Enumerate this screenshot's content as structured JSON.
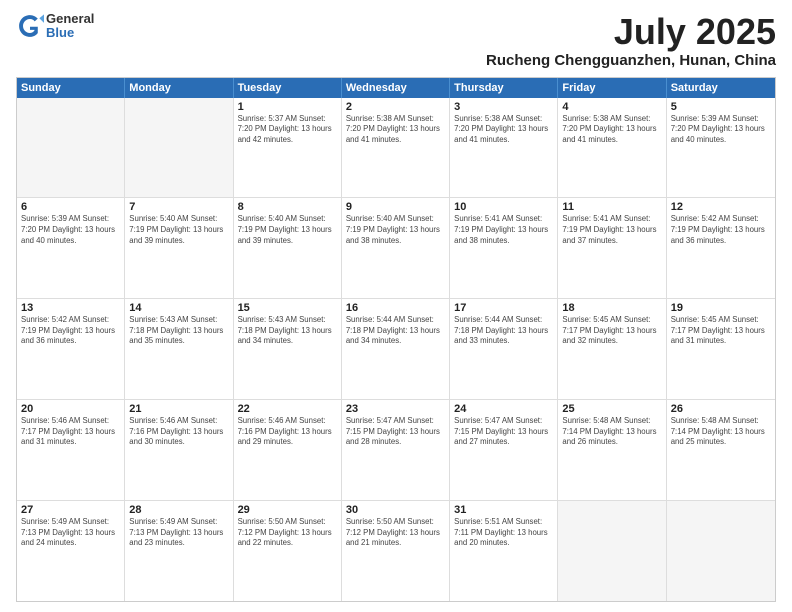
{
  "logo": {
    "general": "General",
    "blue": "Blue"
  },
  "title": "July 2025",
  "subtitle": "Rucheng Chengguanzhen, Hunan, China",
  "days_of_week": [
    "Sunday",
    "Monday",
    "Tuesday",
    "Wednesday",
    "Thursday",
    "Friday",
    "Saturday"
  ],
  "weeks": [
    [
      {
        "day": "",
        "info": "",
        "empty": true
      },
      {
        "day": "",
        "info": "",
        "empty": true
      },
      {
        "day": "1",
        "info": "Sunrise: 5:37 AM\nSunset: 7:20 PM\nDaylight: 13 hours and 42 minutes."
      },
      {
        "day": "2",
        "info": "Sunrise: 5:38 AM\nSunset: 7:20 PM\nDaylight: 13 hours and 41 minutes."
      },
      {
        "day": "3",
        "info": "Sunrise: 5:38 AM\nSunset: 7:20 PM\nDaylight: 13 hours and 41 minutes."
      },
      {
        "day": "4",
        "info": "Sunrise: 5:38 AM\nSunset: 7:20 PM\nDaylight: 13 hours and 41 minutes."
      },
      {
        "day": "5",
        "info": "Sunrise: 5:39 AM\nSunset: 7:20 PM\nDaylight: 13 hours and 40 minutes."
      }
    ],
    [
      {
        "day": "6",
        "info": "Sunrise: 5:39 AM\nSunset: 7:20 PM\nDaylight: 13 hours and 40 minutes."
      },
      {
        "day": "7",
        "info": "Sunrise: 5:40 AM\nSunset: 7:19 PM\nDaylight: 13 hours and 39 minutes."
      },
      {
        "day": "8",
        "info": "Sunrise: 5:40 AM\nSunset: 7:19 PM\nDaylight: 13 hours and 39 minutes."
      },
      {
        "day": "9",
        "info": "Sunrise: 5:40 AM\nSunset: 7:19 PM\nDaylight: 13 hours and 38 minutes."
      },
      {
        "day": "10",
        "info": "Sunrise: 5:41 AM\nSunset: 7:19 PM\nDaylight: 13 hours and 38 minutes."
      },
      {
        "day": "11",
        "info": "Sunrise: 5:41 AM\nSunset: 7:19 PM\nDaylight: 13 hours and 37 minutes."
      },
      {
        "day": "12",
        "info": "Sunrise: 5:42 AM\nSunset: 7:19 PM\nDaylight: 13 hours and 36 minutes."
      }
    ],
    [
      {
        "day": "13",
        "info": "Sunrise: 5:42 AM\nSunset: 7:19 PM\nDaylight: 13 hours and 36 minutes."
      },
      {
        "day": "14",
        "info": "Sunrise: 5:43 AM\nSunset: 7:18 PM\nDaylight: 13 hours and 35 minutes."
      },
      {
        "day": "15",
        "info": "Sunrise: 5:43 AM\nSunset: 7:18 PM\nDaylight: 13 hours and 34 minutes."
      },
      {
        "day": "16",
        "info": "Sunrise: 5:44 AM\nSunset: 7:18 PM\nDaylight: 13 hours and 34 minutes."
      },
      {
        "day": "17",
        "info": "Sunrise: 5:44 AM\nSunset: 7:18 PM\nDaylight: 13 hours and 33 minutes."
      },
      {
        "day": "18",
        "info": "Sunrise: 5:45 AM\nSunset: 7:17 PM\nDaylight: 13 hours and 32 minutes."
      },
      {
        "day": "19",
        "info": "Sunrise: 5:45 AM\nSunset: 7:17 PM\nDaylight: 13 hours and 31 minutes."
      }
    ],
    [
      {
        "day": "20",
        "info": "Sunrise: 5:46 AM\nSunset: 7:17 PM\nDaylight: 13 hours and 31 minutes."
      },
      {
        "day": "21",
        "info": "Sunrise: 5:46 AM\nSunset: 7:16 PM\nDaylight: 13 hours and 30 minutes."
      },
      {
        "day": "22",
        "info": "Sunrise: 5:46 AM\nSunset: 7:16 PM\nDaylight: 13 hours and 29 minutes."
      },
      {
        "day": "23",
        "info": "Sunrise: 5:47 AM\nSunset: 7:15 PM\nDaylight: 13 hours and 28 minutes."
      },
      {
        "day": "24",
        "info": "Sunrise: 5:47 AM\nSunset: 7:15 PM\nDaylight: 13 hours and 27 minutes."
      },
      {
        "day": "25",
        "info": "Sunrise: 5:48 AM\nSunset: 7:14 PM\nDaylight: 13 hours and 26 minutes."
      },
      {
        "day": "26",
        "info": "Sunrise: 5:48 AM\nSunset: 7:14 PM\nDaylight: 13 hours and 25 minutes."
      }
    ],
    [
      {
        "day": "27",
        "info": "Sunrise: 5:49 AM\nSunset: 7:13 PM\nDaylight: 13 hours and 24 minutes."
      },
      {
        "day": "28",
        "info": "Sunrise: 5:49 AM\nSunset: 7:13 PM\nDaylight: 13 hours and 23 minutes."
      },
      {
        "day": "29",
        "info": "Sunrise: 5:50 AM\nSunset: 7:12 PM\nDaylight: 13 hours and 22 minutes."
      },
      {
        "day": "30",
        "info": "Sunrise: 5:50 AM\nSunset: 7:12 PM\nDaylight: 13 hours and 21 minutes."
      },
      {
        "day": "31",
        "info": "Sunrise: 5:51 AM\nSunset: 7:11 PM\nDaylight: 13 hours and 20 minutes."
      },
      {
        "day": "",
        "info": "",
        "empty": true
      },
      {
        "day": "",
        "info": "",
        "empty": true
      }
    ]
  ]
}
